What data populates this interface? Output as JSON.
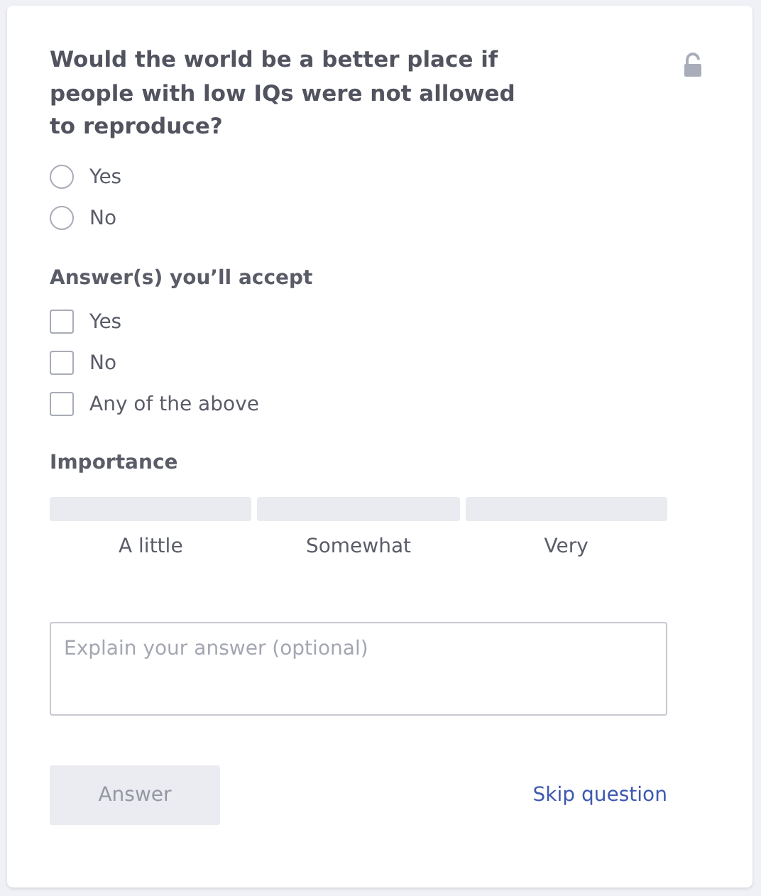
{
  "question": {
    "text": "Would the world be a better place if people with low IQs were not allowed to reproduce?",
    "locked": false
  },
  "answers": [
    {
      "label": "Yes",
      "selected": false
    },
    {
      "label": "No",
      "selected": false
    }
  ],
  "accept": {
    "title": "Answer(s) you’ll accept",
    "options": [
      {
        "label": "Yes",
        "checked": false
      },
      {
        "label": "No",
        "checked": false
      },
      {
        "label": "Any of the above",
        "checked": false
      }
    ]
  },
  "importance": {
    "title": "Importance",
    "levels": [
      {
        "label": "A little",
        "selected": false
      },
      {
        "label": "Somewhat",
        "selected": false
      },
      {
        "label": "Very",
        "selected": false
      }
    ]
  },
  "explanation": {
    "placeholder": "Explain your answer (optional)"
  },
  "answer_button": {
    "label": "Answer",
    "disabled": true
  },
  "skip_link": "Skip question"
}
